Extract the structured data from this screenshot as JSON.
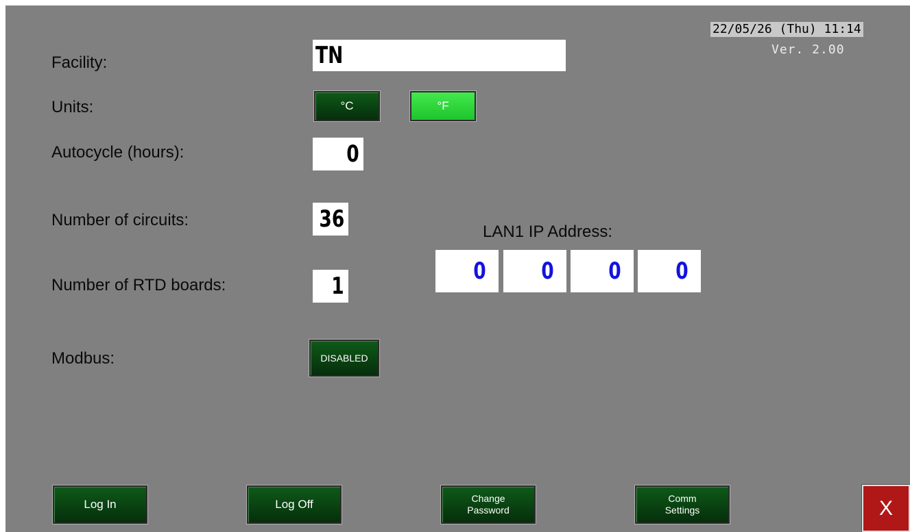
{
  "header": {
    "datetime": "22/05/26 (Thu) 11:14",
    "version": "Ver. 2.00"
  },
  "settings": {
    "facility_label": "Facility:",
    "facility_value": "TN",
    "units_label": "Units:",
    "unit_celsius": "°C",
    "unit_fahrenheit": "°F",
    "selected_unit": "°F",
    "autocycle_label": "Autocycle (hours):",
    "autocycle_value": "0",
    "circuits_label": "Number of circuits:",
    "circuits_value": "36",
    "rtd_label": "Number of RTD boards:",
    "rtd_value": "1",
    "modbus_label": "Modbus:",
    "modbus_value": "DISABLED"
  },
  "network": {
    "lan_label": "LAN1 IP Address:",
    "octets": [
      "0",
      "0",
      "0",
      "0"
    ]
  },
  "footer": {
    "login": "Log In",
    "logoff": "Log Off",
    "change_password": "Change\nPassword",
    "comm_settings": "Comm\nSettings",
    "close": "X"
  },
  "colors": {
    "background": "#808080",
    "button_dark_green": "#0a4a14",
    "button_active_green": "#2ed83a",
    "ip_digit_blue": "#1212e0",
    "close_red": "#b01818"
  }
}
